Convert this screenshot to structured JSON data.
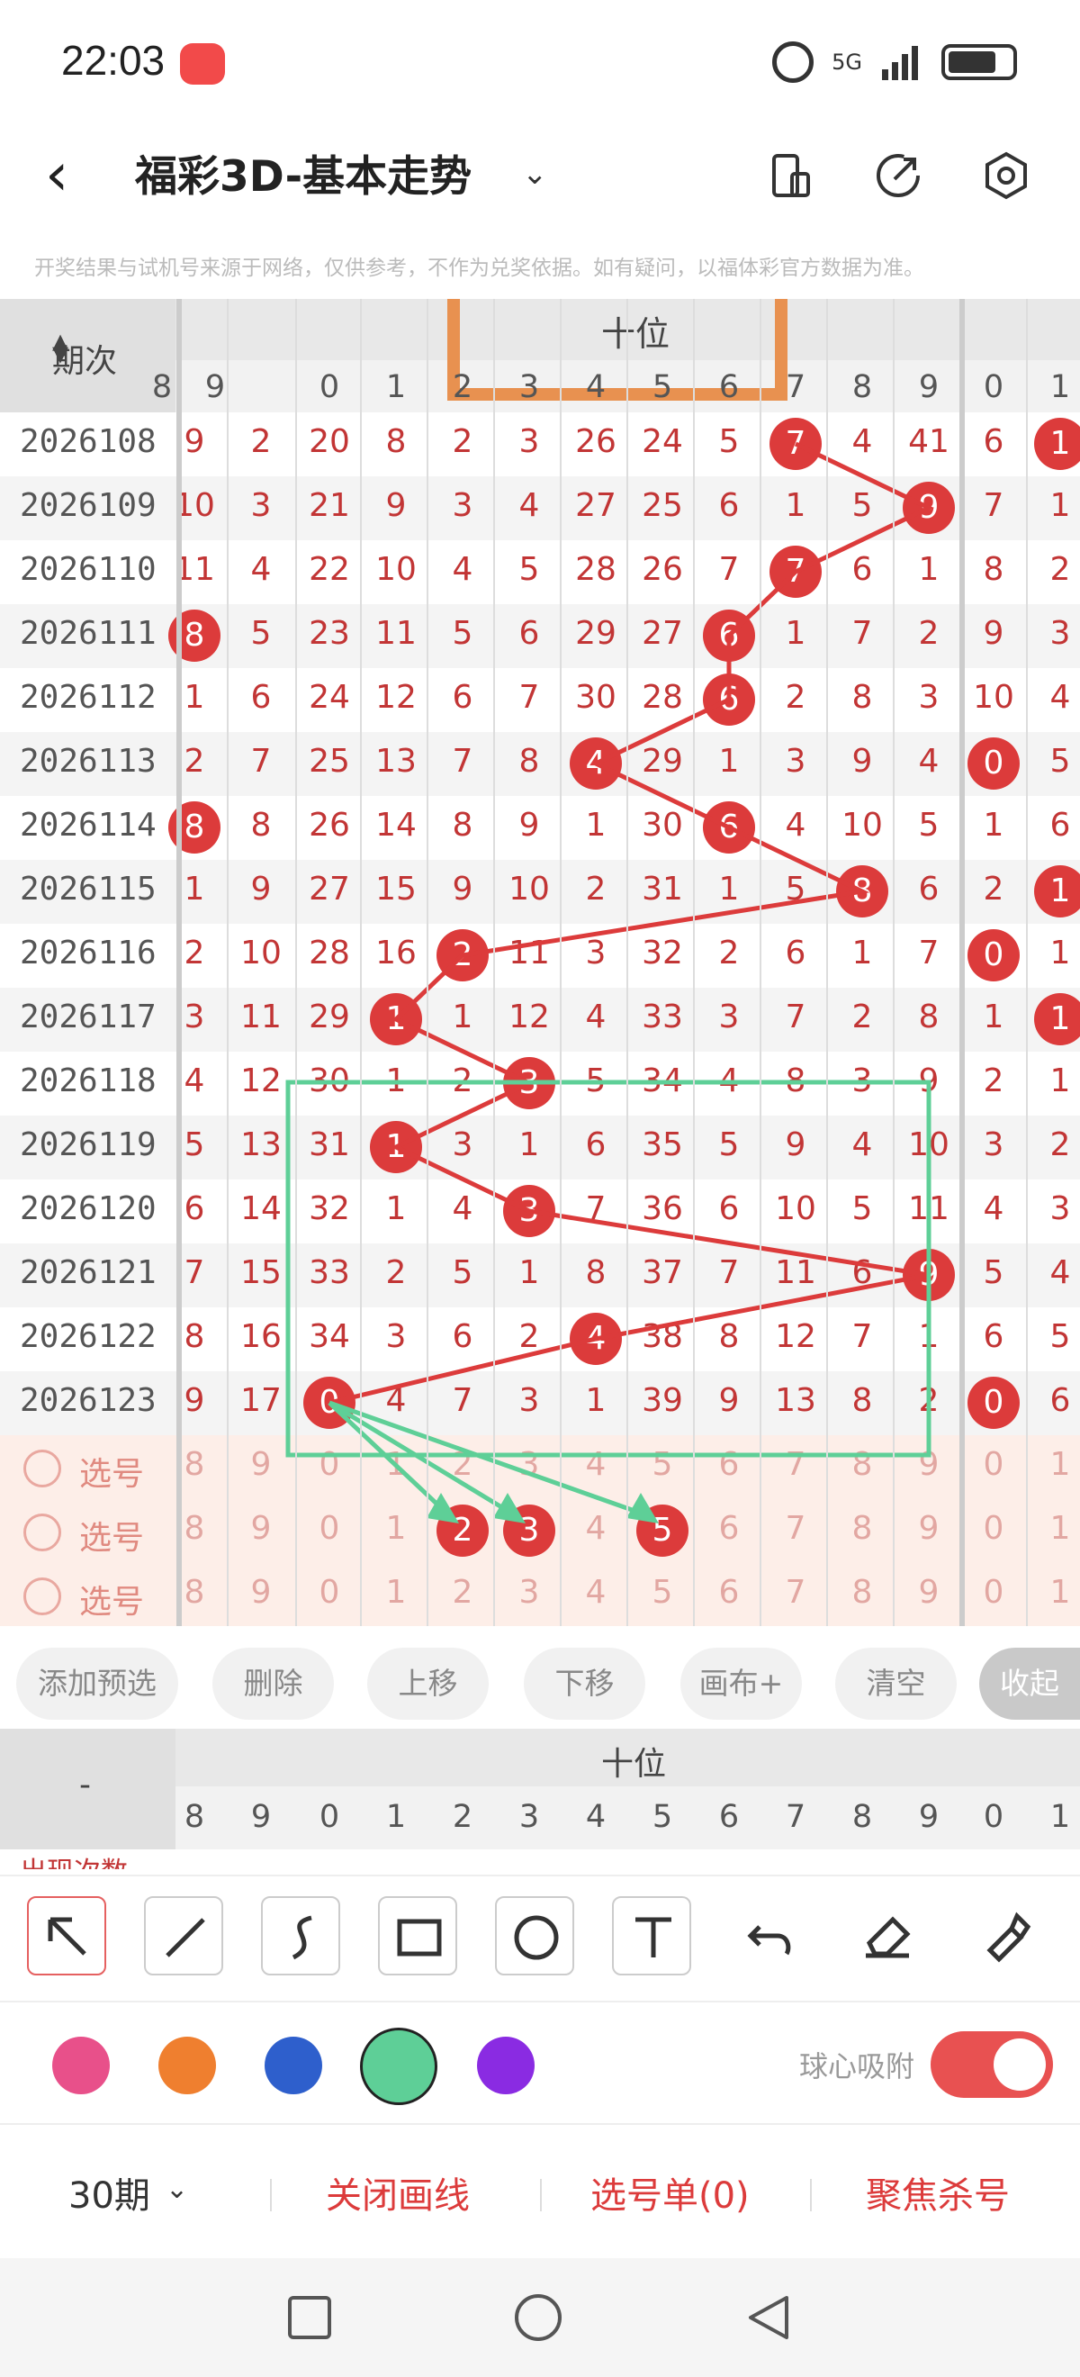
{
  "status_bar": {
    "time": "22:03",
    "network": "5G"
  },
  "header": {
    "title": "福彩3D-基本走势",
    "back_icon": "back-arrow-icon",
    "dropdown_icon": "chevron-down-icon",
    "icons": [
      "phone-layout-icon",
      "share-icon",
      "settings-icon"
    ]
  },
  "disclaimer": "开奖结果与试机号来源于网络，仅供参考，不作为兑奖依据。如有疑问，以福体彩官方数据为准。",
  "table": {
    "period_header": "期次",
    "section_header": "十位",
    "left_digits": [
      "8",
      "9"
    ],
    "digits": [
      "0",
      "1",
      "2",
      "3",
      "4",
      "5",
      "6",
      "7",
      "8",
      "9"
    ],
    "right_digits": [
      "0",
      "1"
    ],
    "rows": [
      {
        "period": "2026108",
        "left": [
          "9",
          "2"
        ],
        "cells": [
          "20",
          "8",
          "2",
          "3",
          "26",
          "24",
          "5",
          "7",
          "4",
          "41"
        ],
        "right": [
          "6",
          "1"
        ],
        "hit": 7,
        "right_hit": 1
      },
      {
        "period": "2026109",
        "left": [
          "10",
          "3"
        ],
        "cells": [
          "21",
          "9",
          "3",
          "4",
          "27",
          "25",
          "6",
          "1",
          "5",
          "9"
        ],
        "right": [
          "7",
          "1"
        ],
        "hit": 9
      },
      {
        "period": "2026110",
        "left": [
          "11",
          "4"
        ],
        "cells": [
          "22",
          "10",
          "4",
          "5",
          "28",
          "26",
          "7",
          "7",
          "6",
          "1"
        ],
        "right": [
          "8",
          "2"
        ],
        "hit": 7
      },
      {
        "period": "2026111",
        "left": [
          "8",
          "5"
        ],
        "cells": [
          "23",
          "11",
          "5",
          "6",
          "29",
          "27",
          "6",
          "1",
          "7",
          "2"
        ],
        "right": [
          "9",
          "3"
        ],
        "hit": 6,
        "left_hit": 0
      },
      {
        "period": "2026112",
        "left": [
          "1",
          "6"
        ],
        "cells": [
          "24",
          "12",
          "6",
          "7",
          "30",
          "28",
          "6",
          "2",
          "8",
          "3"
        ],
        "right": [
          "10",
          "4"
        ],
        "hit": 6
      },
      {
        "period": "2026113",
        "left": [
          "2",
          "7"
        ],
        "cells": [
          "25",
          "13",
          "7",
          "8",
          "4",
          "29",
          "1",
          "3",
          "9",
          "4"
        ],
        "right": [
          "0",
          "5"
        ],
        "hit": 4,
        "right_hit": 0
      },
      {
        "period": "2026114",
        "left": [
          "8",
          "8"
        ],
        "cells": [
          "26",
          "14",
          "8",
          "9",
          "1",
          "30",
          "6",
          "4",
          "10",
          "5"
        ],
        "right": [
          "1",
          "6"
        ],
        "hit": 6,
        "left_hit": 0
      },
      {
        "period": "2026115",
        "left": [
          "1",
          "9"
        ],
        "cells": [
          "27",
          "15",
          "9",
          "10",
          "2",
          "31",
          "1",
          "5",
          "8",
          "6"
        ],
        "right": [
          "2",
          "1"
        ],
        "hit": 8,
        "right_hit": 1
      },
      {
        "period": "2026116",
        "left": [
          "2",
          "10"
        ],
        "cells": [
          "28",
          "16",
          "2",
          "11",
          "3",
          "32",
          "2",
          "6",
          "1",
          "7"
        ],
        "right": [
          "0",
          "1"
        ],
        "hit": 2,
        "right_hit": 0
      },
      {
        "period": "2026117",
        "left": [
          "3",
          "11"
        ],
        "cells": [
          "29",
          "1",
          "1",
          "12",
          "4",
          "33",
          "3",
          "7",
          "2",
          "8"
        ],
        "right": [
          "1",
          "1"
        ],
        "hit": 1,
        "right_hit": 1
      },
      {
        "period": "2026118",
        "left": [
          "4",
          "12"
        ],
        "cells": [
          "30",
          "1",
          "2",
          "3",
          "5",
          "34",
          "4",
          "8",
          "3",
          "9"
        ],
        "right": [
          "2",
          "1"
        ],
        "hit": 3
      },
      {
        "period": "2026119",
        "left": [
          "5",
          "13"
        ],
        "cells": [
          "31",
          "1",
          "3",
          "1",
          "6",
          "35",
          "5",
          "9",
          "4",
          "10"
        ],
        "right": [
          "3",
          "2"
        ],
        "hit": 1
      },
      {
        "period": "2026120",
        "left": [
          "6",
          "14"
        ],
        "cells": [
          "32",
          "1",
          "4",
          "3",
          "7",
          "36",
          "6",
          "10",
          "5",
          "11"
        ],
        "right": [
          "4",
          "3"
        ],
        "hit": 3
      },
      {
        "period": "2026121",
        "left": [
          "7",
          "15"
        ],
        "cells": [
          "33",
          "2",
          "5",
          "1",
          "8",
          "37",
          "7",
          "11",
          "6",
          "9"
        ],
        "right": [
          "5",
          "4"
        ],
        "hit": 9
      },
      {
        "period": "2026122",
        "left": [
          "8",
          "16"
        ],
        "cells": [
          "34",
          "3",
          "6",
          "2",
          "4",
          "38",
          "8",
          "12",
          "7",
          "1"
        ],
        "right": [
          "6",
          "5"
        ],
        "hit": 4
      },
      {
        "period": "2026123",
        "left": [
          "9",
          "17"
        ],
        "cells": [
          "0",
          "4",
          "7",
          "3",
          "1",
          "39",
          "9",
          "13",
          "8",
          "2"
        ],
        "right": [
          "0",
          "6"
        ],
        "hit": 0,
        "right_hit": 0
      }
    ],
    "pick_label": "选号",
    "pick_rows": [
      {
        "balls": []
      },
      {
        "balls": [
          2,
          3,
          5
        ]
      },
      {
        "balls": []
      }
    ]
  },
  "toolbar": {
    "buttons": [
      "添加预选",
      "删除",
      "上移",
      "下移",
      "画布+",
      "清空"
    ],
    "collapse": "收起"
  },
  "stats": {
    "dash": "-",
    "section_header": "十位",
    "cut_label": "出现次数"
  },
  "draw_tools": [
    "arrow-select-icon",
    "line-icon",
    "curve-icon",
    "rectangle-icon",
    "circle-icon",
    "text-icon",
    "undo-icon",
    "eraser-icon",
    "brush-icon"
  ],
  "colors": {
    "palette": [
      "#e8508a",
      "#ef7f2f",
      "#2e5fcc",
      "#5ecf97",
      "#8a2be2"
    ],
    "selected": "#5ecf97"
  },
  "snap": {
    "label": "球心吸附",
    "on": true
  },
  "actions": {
    "period": "30期",
    "close_lines": "关闭画线",
    "pick_list": "选号单(0)",
    "focus": "聚焦杀号"
  }
}
